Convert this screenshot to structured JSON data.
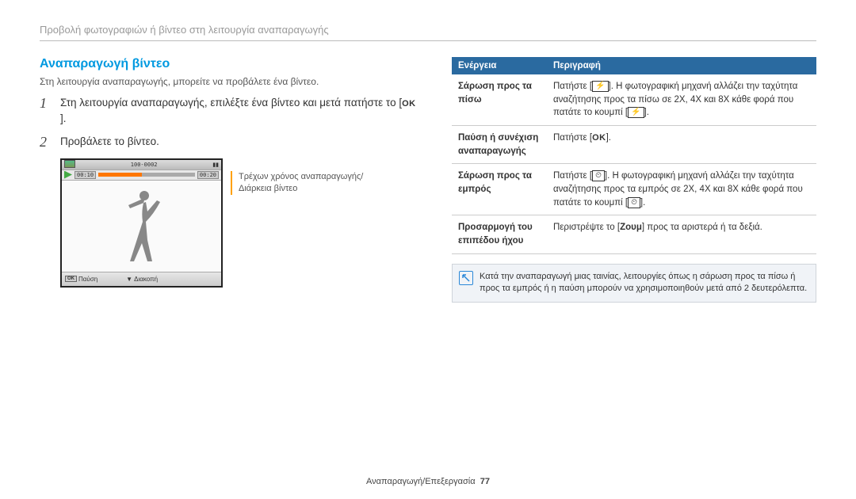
{
  "header": {
    "breadcrumb": "Προβολή φωτογραφιών ή βίντεο στη λειτουργία αναπαραγωγής"
  },
  "section": {
    "title": "Αναπαραγωγή βίντεο",
    "intro": "Στη λειτουργία αναπαραγωγής, μπορείτε να προβάλετε ένα βίντεο."
  },
  "steps": {
    "s1_num": "1",
    "s1_text_a": "Στη λειτουργία αναπαραγωγής, επιλέξτε ένα βίντεο και μετά πατήστε το [",
    "s1_text_b": "].",
    "s2_num": "2",
    "s2_text": "Προβάλετε το βίντεο.",
    "ok_label": "OK"
  },
  "video": {
    "top_left_res": "100-0002",
    "time_current": "00:10",
    "time_total": "00:20",
    "bottom_pause": "Παύση",
    "bottom_stop": "Διακοπή",
    "ok_mini": "OK"
  },
  "annotation": {
    "line1": "Τρέχων χρόνος αναπαραγωγής/",
    "line2": "Διάρκεια βίντεο"
  },
  "table": {
    "head1": "Ενέργεια",
    "head2": "Περιγραφή",
    "rows": [
      {
        "label": "Σάρωση προς τα πίσω",
        "prefix": "Πατήστε [",
        "icon": "⚡",
        "middle": "]. Η φωτογραφική μηχανή αλλάζει την ταχύτητα αναζήτησης προς τα πίσω σε 2X, 4X και 8X κάθε φορά που πατάτε το κουμπί [",
        "icon2": "⚡",
        "suffix": "]."
      },
      {
        "label": "Παύση ή συνέχιση αναπαραγωγής",
        "prefix": "Πατήστε [",
        "icon": "OK",
        "middle": "",
        "icon2": "",
        "suffix": "]."
      },
      {
        "label": "Σάρωση προς τα εμπρός",
        "prefix": "Πατήστε [",
        "icon": "⏲",
        "middle": "]. Η φωτογραφική μηχανή αλλάζει την ταχύτητα αναζήτησης προς τα εμπρός σε 2X, 4X και 8X κάθε φορά που πατάτε το κουμπί [",
        "icon2": "⏲",
        "suffix": "]."
      },
      {
        "label": "Προσαρμογή του επιπέδου ήχου",
        "prefix": "Περιστρέψτε το [",
        "icon": "Ζουμ",
        "middle": "] προς τα αριστερά ή τα δεξιά.",
        "icon2": "",
        "suffix": ""
      }
    ]
  },
  "note": {
    "text": "Κατά την αναπαραγωγή μιας ταινίας, λειτουργίες όπως η σάρωση προς τα πίσω ή προς τα εμπρός ή η παύση μπορούν να χρησιμοποιηθούν μετά από 2 δευτερόλεπτα."
  },
  "footer": {
    "text": "Αναπαραγωγή/Επεξεργασία",
    "page": "77"
  }
}
